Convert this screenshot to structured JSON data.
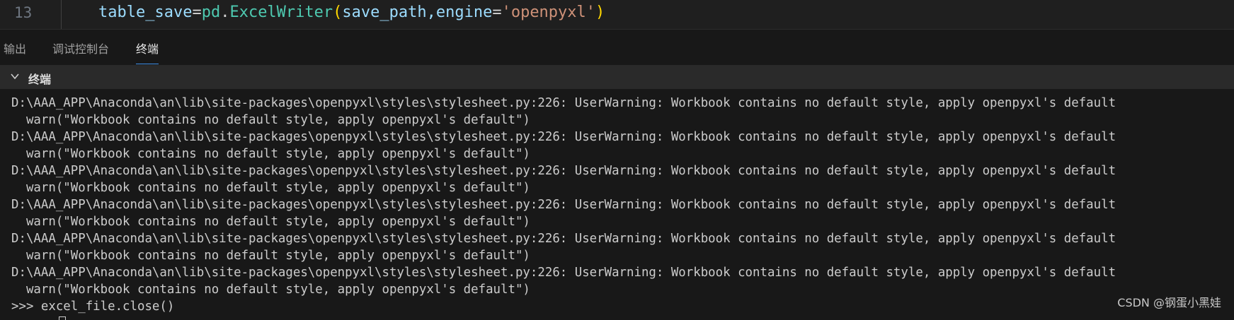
{
  "editor": {
    "line_number": "13",
    "code": {
      "var": "table_save",
      "eq": "=",
      "module": "pd",
      "dot": ".",
      "cls": "ExcelWriter",
      "lparen": "(",
      "arg1": "save_path,engine",
      "eq2": "=",
      "str": "'openpyxl'",
      "rparen": ")"
    }
  },
  "panel_tabs": [
    {
      "label": "输出",
      "active": false
    },
    {
      "label": "调试控制台",
      "active": false
    },
    {
      "label": "终端",
      "active": true
    }
  ],
  "terminal": {
    "section_title": "终端",
    "lines": [
      "D:\\AAA_APP\\Anaconda\\an\\lib\\site-packages\\openpyxl\\styles\\stylesheet.py:226: UserWarning: Workbook contains no default style, apply openpyxl's default",
      "  warn(\"Workbook contains no default style, apply openpyxl's default\")",
      "D:\\AAA_APP\\Anaconda\\an\\lib\\site-packages\\openpyxl\\styles\\stylesheet.py:226: UserWarning: Workbook contains no default style, apply openpyxl's default",
      "  warn(\"Workbook contains no default style, apply openpyxl's default\")",
      "D:\\AAA_APP\\Anaconda\\an\\lib\\site-packages\\openpyxl\\styles\\stylesheet.py:226: UserWarning: Workbook contains no default style, apply openpyxl's default",
      "  warn(\"Workbook contains no default style, apply openpyxl's default\")",
      "D:\\AAA_APP\\Anaconda\\an\\lib\\site-packages\\openpyxl\\styles\\stylesheet.py:226: UserWarning: Workbook contains no default style, apply openpyxl's default",
      "  warn(\"Workbook contains no default style, apply openpyxl's default\")",
      "D:\\AAA_APP\\Anaconda\\an\\lib\\site-packages\\openpyxl\\styles\\stylesheet.py:226: UserWarning: Workbook contains no default style, apply openpyxl's default",
      "  warn(\"Workbook contains no default style, apply openpyxl's default\")",
      "D:\\AAA_APP\\Anaconda\\an\\lib\\site-packages\\openpyxl\\styles\\stylesheet.py:226: UserWarning: Workbook contains no default style, apply openpyxl's default",
      "  warn(\"Workbook contains no default style, apply openpyxl's default\")",
      ">>> excel_file.close()"
    ],
    "cursor_icon": "block-cursor"
  },
  "watermark": "CSDN @钢蛋小黑娃",
  "colors": {
    "background": "#1f1f1f",
    "panel_background": "#181818",
    "accent": "#3c8ee8"
  }
}
